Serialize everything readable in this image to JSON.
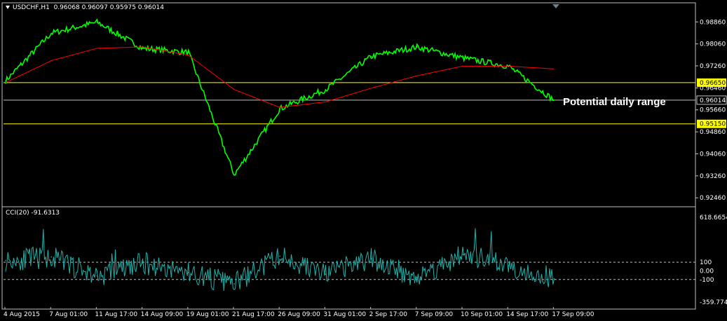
{
  "window": {
    "symbol": "USDCHF,H1",
    "ohlc": "0.96068 0.96097 0.95975 0.96014"
  },
  "indicator": {
    "label": "CCI(20) -91.6313"
  },
  "annotation": "Potential daily range",
  "colors": {
    "background": "#000000",
    "price": "#00ff00",
    "moving_average": "#ff0000",
    "range_lines": "#ffff00",
    "current_price_line": "#c0c0c0",
    "cci": "#20b2aa",
    "frame": "#c0c0c0"
  },
  "chart_data": [
    {
      "type": "line",
      "title": "",
      "series": [
        {
          "name": "",
          "role": "price",
          "x": [
            "4 Aug 2015",
            "7 Aug 01:00",
            "11 Aug 17:00",
            "14 Aug 09:00",
            "19 Aug 01:00",
            "21 Aug 17:00",
            "26 Aug 09:00",
            "31 Aug 01:00",
            "2 Sep 17:00",
            "7 Sep 09:00",
            "10 Sep 01:00",
            "14 Sep 17:00",
            "17 Sep 09:00"
          ],
          "values": [
            0.9672,
            0.9845,
            0.9885,
            0.979,
            0.9775,
            0.933,
            0.957,
            0.964,
            0.976,
            0.9795,
            0.9755,
            0.9725,
            0.9601
          ]
        },
        {
          "name": "",
          "role": "moving-average",
          "x": [
            "4 Aug 2015",
            "7 Aug 01:00",
            "11 Aug 17:00",
            "14 Aug 09:00",
            "19 Aug 01:00",
            "21 Aug 17:00",
            "26 Aug 09:00",
            "31 Aug 01:00",
            "2 Sep 17:00",
            "7 Sep 09:00",
            "10 Sep 01:00",
            "14 Sep 17:00",
            "17 Sep 09:00"
          ],
          "values": [
            0.9665,
            0.9745,
            0.979,
            0.9795,
            0.9765,
            0.964,
            0.9575,
            0.9595,
            0.9645,
            0.969,
            0.9725,
            0.9725,
            0.9715
          ]
        }
      ],
      "horizontal_lines": [
        {
          "value": "0.96650",
          "highlighted": true
        },
        {
          "value": "0.96014",
          "highlighted": false
        },
        {
          "value": "0.95150",
          "highlighted": true
        }
      ],
      "y_ticks": [
        "0.98860",
        "0.98060",
        "0.97260",
        "0.96460",
        "0.95660",
        "0.94860",
        "0.94060",
        "0.93260",
        "0.92460"
      ],
      "ylim": [
        0.9216,
        0.993
      ]
    },
    {
      "type": "line",
      "title": "",
      "series": [
        {
          "name": "",
          "role": "cci",
          "x": [
            "4 Aug 2015",
            "7 Aug 01:00",
            "11 Aug 17:00",
            "14 Aug 09:00",
            "19 Aug 01:00",
            "21 Aug 17:00",
            "26 Aug 09:00",
            "31 Aug 01:00",
            "2 Sep 17:00",
            "7 Sep 09:00",
            "10 Sep 01:00",
            "14 Sep 17:00",
            "17 Sep 09:00"
          ],
          "values": [
            120,
            160,
            -60,
            90,
            -20,
            -150,
            170,
            -40,
            140,
            -80,
            190,
            60,
            -92
          ]
        }
      ],
      "levels": [
        "100",
        "-100"
      ],
      "y_ticks": [
        "618.6654",
        "100",
        "0.00",
        "-100",
        "-359.7749"
      ],
      "ylim": [
        -410,
        660
      ]
    }
  ],
  "x_ticks": [
    "4 Aug 2015",
    "7 Aug 01:00",
    "11 Aug 17:00",
    "14 Aug 09:00",
    "19 Aug 01:00",
    "21 Aug 17:00",
    "26 Aug 09:00",
    "31 Aug 01:00",
    "2 Sep 17:00",
    "7 Sep 09:00",
    "10 Sep 01:00",
    "14 Sep 17:00",
    "17 Sep 09:00"
  ]
}
